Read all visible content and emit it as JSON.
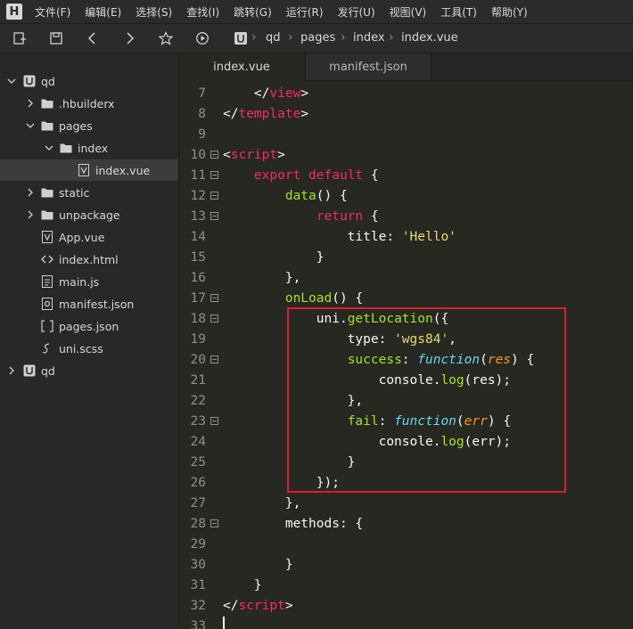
{
  "menubar": {
    "logo": "H",
    "items": [
      "文件(F)",
      "编辑(E)",
      "选择(S)",
      "查找(I)",
      "跳转(G)",
      "运行(R)",
      "发行(U)",
      "视图(V)",
      "工具(T)",
      "帮助(Y)"
    ]
  },
  "toolbar": {
    "breadcrumb": [
      "qd",
      "pages",
      "index",
      "index.vue"
    ]
  },
  "sidebar": {
    "items": [
      {
        "label": "qd",
        "type": "project",
        "expanded": true
      },
      {
        "label": ".hbuilderx",
        "type": "folder",
        "expanded": false
      },
      {
        "label": "pages",
        "type": "folder",
        "expanded": true
      },
      {
        "label": "index",
        "type": "folder",
        "expanded": true
      },
      {
        "label": "index.vue",
        "type": "vue-file",
        "selected": true
      },
      {
        "label": "static",
        "type": "folder",
        "expanded": false
      },
      {
        "label": "unpackage",
        "type": "folder",
        "expanded": false
      },
      {
        "label": "App.vue",
        "type": "vue-file"
      },
      {
        "label": "index.html",
        "type": "html-file"
      },
      {
        "label": "main.js",
        "type": "js-file"
      },
      {
        "label": "manifest.json",
        "type": "manifest-file"
      },
      {
        "label": "pages.json",
        "type": "json-file"
      },
      {
        "label": "uni.scss",
        "type": "scss-file"
      },
      {
        "label": "qd",
        "type": "project",
        "expanded": false
      }
    ]
  },
  "tabs": [
    {
      "label": "index.vue",
      "active": true
    },
    {
      "label": "manifest.json",
      "active": false
    }
  ],
  "editor": {
    "lines": [
      {
        "n": "7",
        "fold": false,
        "tokens": [
          [
            "",
            "    "
          ],
          [
            "punct",
            "</"
          ],
          [
            "tag",
            "view"
          ],
          [
            "punct",
            ">"
          ]
        ]
      },
      {
        "n": "8",
        "fold": false,
        "tokens": [
          [
            "punct",
            "</"
          ],
          [
            "tag",
            "template"
          ],
          [
            "punct",
            ">"
          ]
        ]
      },
      {
        "n": "9",
        "fold": false,
        "tokens": []
      },
      {
        "n": "10",
        "fold": true,
        "tokens": [
          [
            "punct",
            "<"
          ],
          [
            "tag",
            "script"
          ],
          [
            "punct",
            ">"
          ]
        ]
      },
      {
        "n": "11",
        "fold": true,
        "tokens": [
          [
            "",
            "    "
          ],
          [
            "kw",
            "export"
          ],
          [
            "",
            " "
          ],
          [
            "kw",
            "default"
          ],
          [
            "punct",
            " {"
          ]
        ]
      },
      {
        "n": "12",
        "fold": true,
        "tokens": [
          [
            "",
            "        "
          ],
          [
            "fn",
            "data"
          ],
          [
            "punct",
            "() {"
          ]
        ]
      },
      {
        "n": "13",
        "fold": true,
        "tokens": [
          [
            "",
            "            "
          ],
          [
            "kw",
            "return"
          ],
          [
            "punct",
            " {"
          ]
        ]
      },
      {
        "n": "14",
        "fold": false,
        "tokens": [
          [
            "",
            "                title: "
          ],
          [
            "str",
            "'Hello'"
          ]
        ]
      },
      {
        "n": "15",
        "fold": false,
        "tokens": [
          [
            "",
            "            }"
          ]
        ]
      },
      {
        "n": "16",
        "fold": false,
        "tokens": [
          [
            "",
            "        },"
          ]
        ]
      },
      {
        "n": "17",
        "fold": true,
        "tokens": [
          [
            "",
            "        "
          ],
          [
            "fn",
            "onLoad"
          ],
          [
            "punct",
            "() {"
          ]
        ]
      },
      {
        "n": "18",
        "fold": true,
        "tokens": [
          [
            "",
            "            uni."
          ],
          [
            "fn",
            "getLocation"
          ],
          [
            "punct",
            "({"
          ]
        ]
      },
      {
        "n": "19",
        "fold": false,
        "tokens": [
          [
            "",
            "                type: "
          ],
          [
            "str",
            "'wgs84'"
          ],
          [
            "punct",
            ","
          ]
        ]
      },
      {
        "n": "20",
        "fold": true,
        "tokens": [
          [
            "",
            "                "
          ],
          [
            "fn",
            "success"
          ],
          [
            "punct",
            ": "
          ],
          [
            "ital",
            "function"
          ],
          [
            "punct",
            "("
          ],
          [
            "param",
            "res"
          ],
          [
            "punct",
            ") {"
          ]
        ]
      },
      {
        "n": "21",
        "fold": false,
        "tokens": [
          [
            "",
            "                    console."
          ],
          [
            "fn",
            "log"
          ],
          [
            "punct",
            "(res);"
          ]
        ]
      },
      {
        "n": "22",
        "fold": false,
        "tokens": [
          [
            "",
            "                },"
          ]
        ]
      },
      {
        "n": "23",
        "fold": true,
        "tokens": [
          [
            "",
            "                "
          ],
          [
            "fn",
            "fail"
          ],
          [
            "punct",
            ": "
          ],
          [
            "ital",
            "function"
          ],
          [
            "punct",
            "("
          ],
          [
            "param",
            "err"
          ],
          [
            "punct",
            ") {"
          ]
        ]
      },
      {
        "n": "24",
        "fold": false,
        "tokens": [
          [
            "",
            "                    console."
          ],
          [
            "fn",
            "log"
          ],
          [
            "punct",
            "(err);"
          ]
        ]
      },
      {
        "n": "25",
        "fold": false,
        "tokens": [
          [
            "",
            "                }"
          ]
        ]
      },
      {
        "n": "26",
        "fold": false,
        "tokens": [
          [
            "",
            "            });"
          ]
        ]
      },
      {
        "n": "27",
        "fold": false,
        "tokens": [
          [
            "",
            "        },"
          ]
        ]
      },
      {
        "n": "28",
        "fold": true,
        "tokens": [
          [
            "",
            "        methods: {"
          ]
        ]
      },
      {
        "n": "29",
        "fold": false,
        "tokens": []
      },
      {
        "n": "30",
        "fold": false,
        "tokens": [
          [
            "",
            "        }"
          ]
        ]
      },
      {
        "n": "31",
        "fold": false,
        "tokens": [
          [
            "",
            "    }"
          ]
        ]
      },
      {
        "n": "32",
        "fold": false,
        "tokens": [
          [
            "punct",
            "</"
          ],
          [
            "tag",
            "script"
          ],
          [
            "punct",
            ">"
          ]
        ]
      },
      {
        "n": "33",
        "fold": false,
        "tokens": []
      }
    ]
  }
}
